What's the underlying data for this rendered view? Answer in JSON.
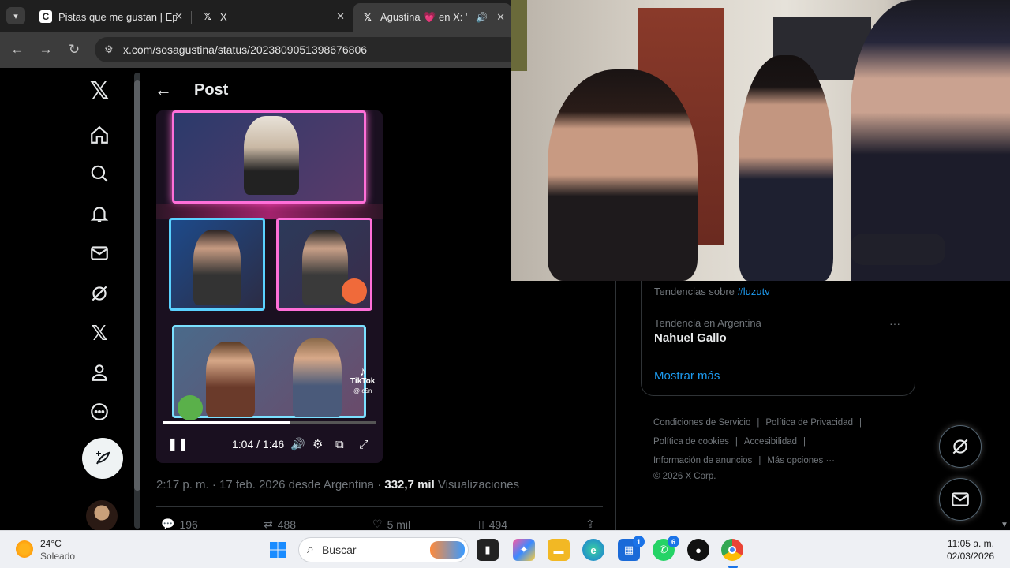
{
  "browser": {
    "tabs": [
      {
        "title": "Pistas que me gustan | Ep",
        "favicon": "generic-page-icon"
      },
      {
        "title": "X",
        "favicon": "x-logo-icon"
      },
      {
        "title": "Agustina 💗 en X: \"E",
        "favicon": "x-logo-icon",
        "active": true,
        "audio": true
      }
    ],
    "url": "x.com/sosagustina/status/2023809051398676806"
  },
  "post": {
    "header_title": "Post",
    "video": {
      "current_time": "1:04",
      "duration": "1:46",
      "time_sep": " / ",
      "progress": 0.6,
      "watermark": "TikTok",
      "watermark_handle": "@ c5n"
    },
    "meta": {
      "datetime": "2:17 p. m. · 17 feb. 2026 desde Argentina · ",
      "views": "332,7 mil",
      "views_label": " Visualizaciones"
    },
    "actions": {
      "replies": "196",
      "reposts": "488",
      "likes": "5 mil",
      "bookmarks": "494"
    }
  },
  "trends": {
    "trend_about_prefix": "Tendencias sobre ",
    "trend_about_tag": "#luzutv",
    "trend_label": "Tendencia en Argentina",
    "trend_name": "Nahuel Gallo",
    "more_menu": "···",
    "show_more": "Mostrar más"
  },
  "footer": {
    "terms": "Condiciones de Servicio",
    "privacy": "Política de Privacidad",
    "cookies": "Política de cookies",
    "accessibility": "Accesibilidad",
    "ads_info": "Información de anuncios",
    "more_options": "Más opciones ···",
    "copyright": "© 2026 X Corp."
  },
  "taskbar": {
    "weather_temp": "24°C",
    "weather_desc": "Soleado",
    "search_placeholder": "Buscar",
    "time": "11:05 a. m.",
    "date": "02/03/2026",
    "store_badge": "1",
    "whatsapp_badge": "6"
  },
  "colors": {
    "accent": "#1d9bf0",
    "bg": "#000000",
    "muted": "#71767b"
  }
}
